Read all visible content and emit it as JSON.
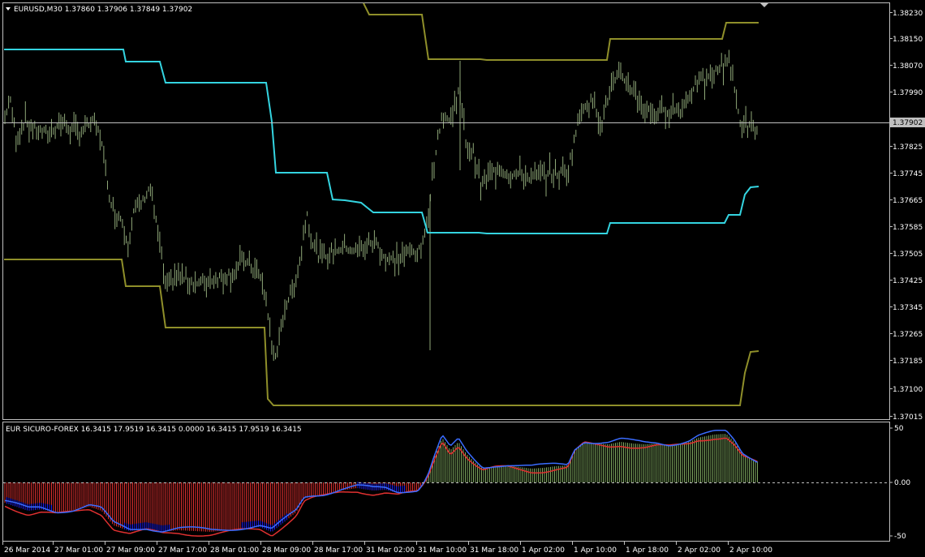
{
  "colors": {
    "background": "#000000",
    "frame": "#c0c0c0",
    "bars": "#8fa878",
    "channel_cyan": "#34d4e0",
    "channel_olive": "#8f8f2a",
    "osc_red": "#e03030",
    "osc_blue": "#1e1ef0",
    "osc_green": "#7fa860",
    "price_label_bg": "#c0c0c0"
  },
  "main_chart": {
    "header": "EURUSD,M30  1.37860 1.37906 1.37849 1.37902",
    "current_price_label": "1.37902",
    "price_ticks": [
      "1.38230",
      "1.38150",
      "1.38070",
      "1.37990",
      "1.37902",
      "1.37825",
      "1.37745",
      "1.37665",
      "1.37585",
      "1.37505",
      "1.37425",
      "1.37345",
      "1.37265",
      "1.37185",
      "1.37100",
      "1.37015"
    ]
  },
  "indicator": {
    "header": "EUR SICURO-FOREX 16.3415 17.9519 16.3415 0.0000 16.3415 17.9519 16.3415",
    "ticks": [
      "50",
      "0.00",
      "-50"
    ]
  },
  "time_axis": {
    "labels": [
      "26 Mar 2014",
      "27 Mar 01:00",
      "27 Mar 09:00",
      "27 Mar 17:00",
      "28 Mar 01:00",
      "28 Mar 09:00",
      "28 Mar 17:00",
      "31 Mar 02:00",
      "31 Mar 10:00",
      "31 Mar 18:00",
      "1 Apr 02:00",
      "1 Apr 10:00",
      "1 Apr 18:00",
      "2 Apr 02:00",
      "2 Apr 10:00"
    ]
  }
}
